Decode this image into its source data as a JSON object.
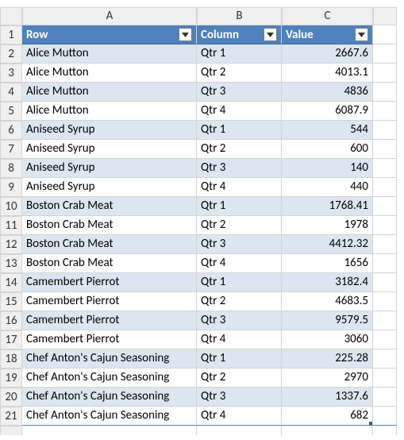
{
  "columns": [
    "A",
    "B",
    "C"
  ],
  "headers": {
    "A": "Row",
    "B": "Column",
    "C": "Value"
  },
  "rows": [
    {
      "n": "1"
    },
    {
      "n": "2",
      "A": "Alice Mutton",
      "B": "Qtr 1",
      "C": "2667.6"
    },
    {
      "n": "3",
      "A": "Alice Mutton",
      "B": "Qtr 2",
      "C": "4013.1"
    },
    {
      "n": "4",
      "A": "Alice Mutton",
      "B": "Qtr 3",
      "C": "4836"
    },
    {
      "n": "5",
      "A": "Alice Mutton",
      "B": "Qtr 4",
      "C": "6087.9"
    },
    {
      "n": "6",
      "A": "Aniseed Syrup",
      "B": "Qtr 1",
      "C": "544"
    },
    {
      "n": "7",
      "A": "Aniseed Syrup",
      "B": "Qtr 2",
      "C": "600"
    },
    {
      "n": "8",
      "A": "Aniseed Syrup",
      "B": "Qtr 3",
      "C": "140"
    },
    {
      "n": "9",
      "A": "Aniseed Syrup",
      "B": "Qtr 4",
      "C": "440"
    },
    {
      "n": "10",
      "A": "Boston Crab Meat",
      "B": "Qtr 1",
      "C": "1768.41"
    },
    {
      "n": "11",
      "A": "Boston Crab Meat",
      "B": "Qtr 2",
      "C": "1978"
    },
    {
      "n": "12",
      "A": "Boston Crab Meat",
      "B": "Qtr 3",
      "C": "4412.32"
    },
    {
      "n": "13",
      "A": "Boston Crab Meat",
      "B": "Qtr 4",
      "C": "1656"
    },
    {
      "n": "14",
      "A": "Camembert Pierrot",
      "B": "Qtr 1",
      "C": "3182.4"
    },
    {
      "n": "15",
      "A": "Camembert Pierrot",
      "B": "Qtr 2",
      "C": "4683.5"
    },
    {
      "n": "16",
      "A": "Camembert Pierrot",
      "B": "Qtr 3",
      "C": "9579.5"
    },
    {
      "n": "17",
      "A": "Camembert Pierrot",
      "B": "Qtr 4",
      "C": "3060"
    },
    {
      "n": "18",
      "A": "Chef Anton's Cajun Seasoning",
      "B": "Qtr 1",
      "C": "225.28"
    },
    {
      "n": "19",
      "A": "Chef Anton's Cajun Seasoning",
      "B": "Qtr 2",
      "C": "2970"
    },
    {
      "n": "20",
      "A": "Chef Anton's Cajun Seasoning",
      "B": "Qtr 3",
      "C": "1337.6"
    },
    {
      "n": "21",
      "A": "Chef Anton's Cajun Seasoning",
      "B": "Qtr 4",
      "C": "682"
    }
  ],
  "chart_data": {
    "type": "table",
    "columns": [
      "Row",
      "Column",
      "Value"
    ],
    "data": [
      [
        "Alice Mutton",
        "Qtr 1",
        2667.6
      ],
      [
        "Alice Mutton",
        "Qtr 2",
        4013.1
      ],
      [
        "Alice Mutton",
        "Qtr 3",
        4836
      ],
      [
        "Alice Mutton",
        "Qtr 4",
        6087.9
      ],
      [
        "Aniseed Syrup",
        "Qtr 1",
        544
      ],
      [
        "Aniseed Syrup",
        "Qtr 2",
        600
      ],
      [
        "Aniseed Syrup",
        "Qtr 3",
        140
      ],
      [
        "Aniseed Syrup",
        "Qtr 4",
        440
      ],
      [
        "Boston Crab Meat",
        "Qtr 1",
        1768.41
      ],
      [
        "Boston Crab Meat",
        "Qtr 2",
        1978
      ],
      [
        "Boston Crab Meat",
        "Qtr 3",
        4412.32
      ],
      [
        "Boston Crab Meat",
        "Qtr 4",
        1656
      ],
      [
        "Camembert Pierrot",
        "Qtr 1",
        3182.4
      ],
      [
        "Camembert Pierrot",
        "Qtr 2",
        4683.5
      ],
      [
        "Camembert Pierrot",
        "Qtr 3",
        9579.5
      ],
      [
        "Camembert Pierrot",
        "Qtr 4",
        3060
      ],
      [
        "Chef Anton's Cajun Seasoning",
        "Qtr 1",
        225.28
      ],
      [
        "Chef Anton's Cajun Seasoning",
        "Qtr 2",
        2970
      ],
      [
        "Chef Anton's Cajun Seasoning",
        "Qtr 3",
        1337.6
      ],
      [
        "Chef Anton's Cajun Seasoning",
        "Qtr 4",
        682
      ]
    ]
  }
}
